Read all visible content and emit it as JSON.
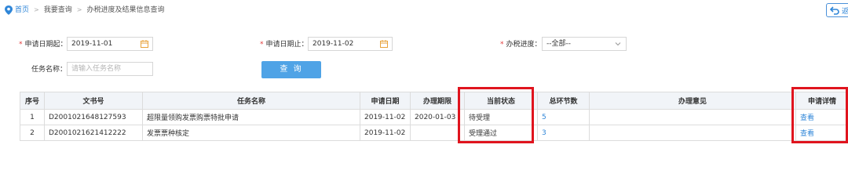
{
  "breadcrumb": {
    "items": [
      "首页",
      "我要查询",
      "办税进度及结果信息查询"
    ],
    "separator": ">"
  },
  "return_button": {
    "label": "返"
  },
  "form": {
    "start_date": {
      "label": "申请日期起：",
      "value": "2019-11-01"
    },
    "end_date": {
      "label": "申请日期止：",
      "value": "2019-11-02"
    },
    "progress": {
      "label": "办税进度：",
      "value": "--全部--"
    },
    "task_name": {
      "label": "任务名称：",
      "placeholder": "请输入任务名称"
    },
    "query_button": "查 询"
  },
  "table": {
    "headers": [
      "序号",
      "文书号",
      "任务名称",
      "申请日期",
      "办理期限",
      "当前状态",
      "总环节数",
      "办理意见",
      "申请详情"
    ],
    "rows": [
      {
        "seq": "1",
        "doc_no": "D2001021648127593",
        "task": "超限量领购发票购票特批申请",
        "apply_date": "2019-11-02",
        "deadline": "2020-01-03",
        "status": "待受理",
        "steps": "5",
        "opinion": "",
        "detail": "查看"
      },
      {
        "seq": "2",
        "doc_no": "D2001021621412222",
        "task": "发票票种核定",
        "apply_date": "2019-11-02",
        "deadline": "",
        "status": "受理通过",
        "steps": "3",
        "opinion": "",
        "detail": "查看"
      }
    ]
  },
  "colors": {
    "link": "#2f86d8",
    "primary_button": "#4fa3e6",
    "highlight_box": "#e0141e",
    "required_mark": "#e23a3a",
    "header_bg": "#f1f4f8"
  }
}
